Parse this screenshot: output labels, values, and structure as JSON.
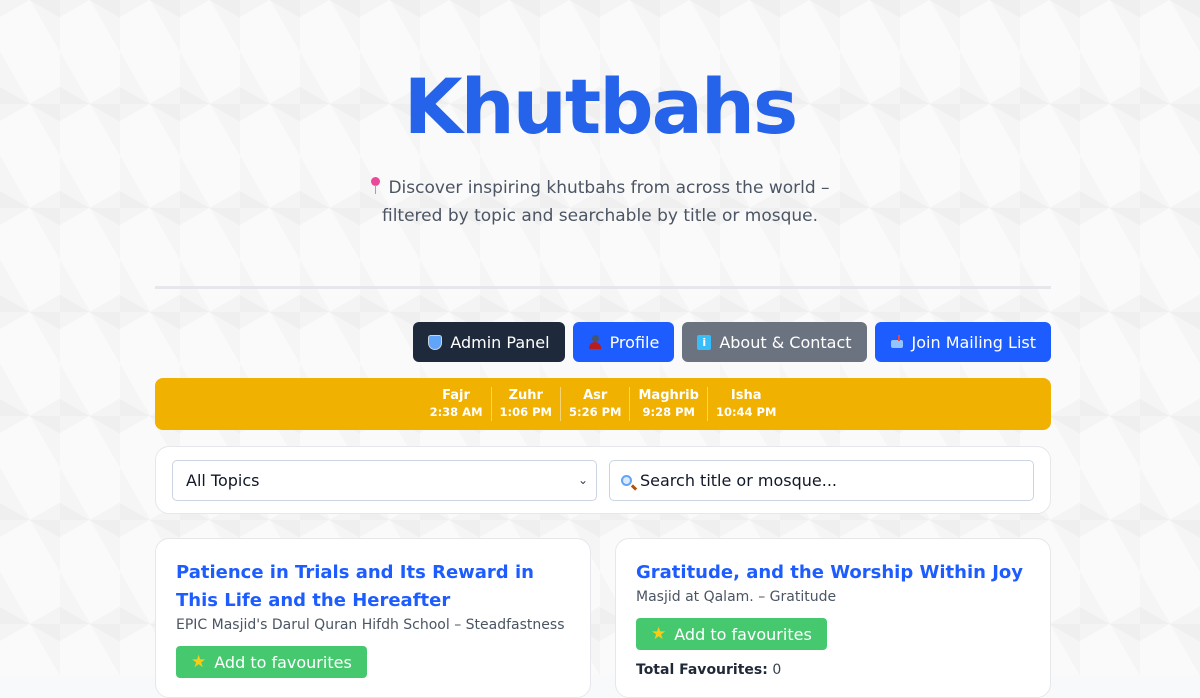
{
  "header": {
    "title": "Khutbahs",
    "tagline_line1": "Discover inspiring khutbahs from across the world –",
    "tagline_line2": "filtered by topic and searchable by title or mosque."
  },
  "nav": {
    "admin": "Admin Panel",
    "profile": "Profile",
    "about": "About & Contact",
    "mailing": "Join Mailing List",
    "info_glyph": "i"
  },
  "prayer_times": [
    {
      "name": "Fajr",
      "time": "2:38 AM"
    },
    {
      "name": "Zuhr",
      "time": "1:06 PM"
    },
    {
      "name": "Asr",
      "time": "5:26 PM"
    },
    {
      "name": "Maghrib",
      "time": "9:28 PM"
    },
    {
      "name": "Isha",
      "time": "10:44 PM"
    }
  ],
  "filters": {
    "topic_selected": "All Topics",
    "search_placeholder": "Search title or mosque..."
  },
  "khutbahs": [
    {
      "title": "Patience in Trials and Its Reward in This Life and the Hereafter",
      "meta": "EPIC Masjid's Darul Quran Hifdh School – Steadfastness",
      "fav_label": "Add to favourites"
    },
    {
      "title": "Gratitude, and the Worship Within Joy",
      "meta": "Masjid at Qalam. – Gratitude",
      "fav_label": "Add to favourites",
      "total_label": "Total Favourites:",
      "total_value": "0"
    }
  ],
  "colors": {
    "brand_blue": "#2563eb",
    "prayer_bar": "#f0b100",
    "fav_green": "#46c96e"
  }
}
